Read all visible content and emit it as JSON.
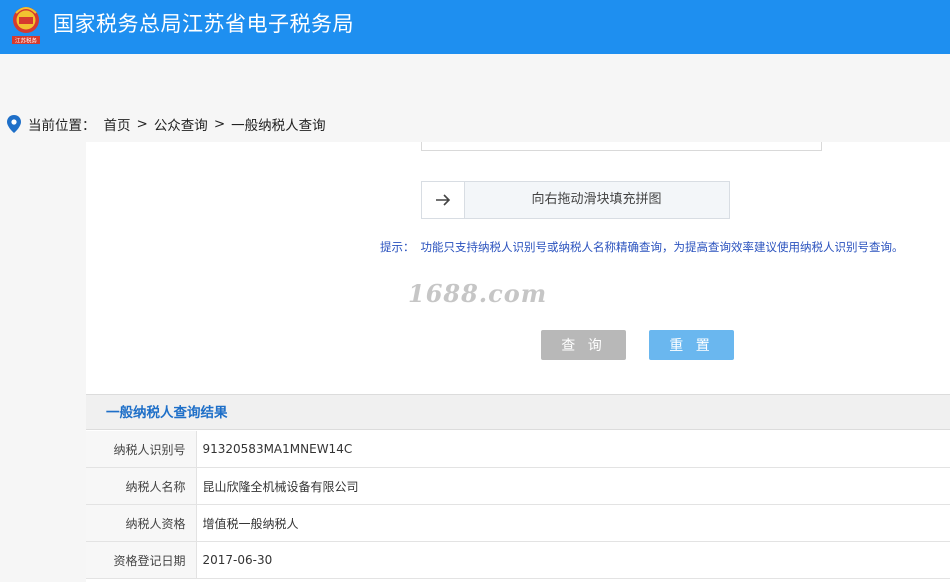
{
  "header": {
    "title": "国家税务总局江苏省电子税务局",
    "emblem_caption": "江苏税务",
    "brand_color": "#1e8ff0"
  },
  "breadcrumb": {
    "icon": "location-pin-icon",
    "label": "当前位置：",
    "items": [
      "首页",
      "公众查询",
      "一般纳税人查询"
    ],
    "separator": ">"
  },
  "captcha": {
    "arrow_icon": "arrow-right-icon",
    "text": "向右拖动滑块填充拼图"
  },
  "hint": {
    "label": "提示：",
    "text": "功能只支持纳税人识别号或纳税人名称精确查询，为提高查询效率建议使用纳税人识别号查询。"
  },
  "watermark": "1688.com",
  "buttons": {
    "query": "查 询",
    "reset": "重 置"
  },
  "result": {
    "title": "一般纳税人查询结果",
    "rows": [
      {
        "label": "纳税人识别号",
        "value": "91320583MA1MNEW14C"
      },
      {
        "label": "纳税人名称",
        "value": "昆山欣隆全机械设备有限公司"
      },
      {
        "label": "纳税人资格",
        "value": "增值税一般纳税人"
      },
      {
        "label": "资格登记日期",
        "value": "2017-06-30"
      }
    ]
  }
}
